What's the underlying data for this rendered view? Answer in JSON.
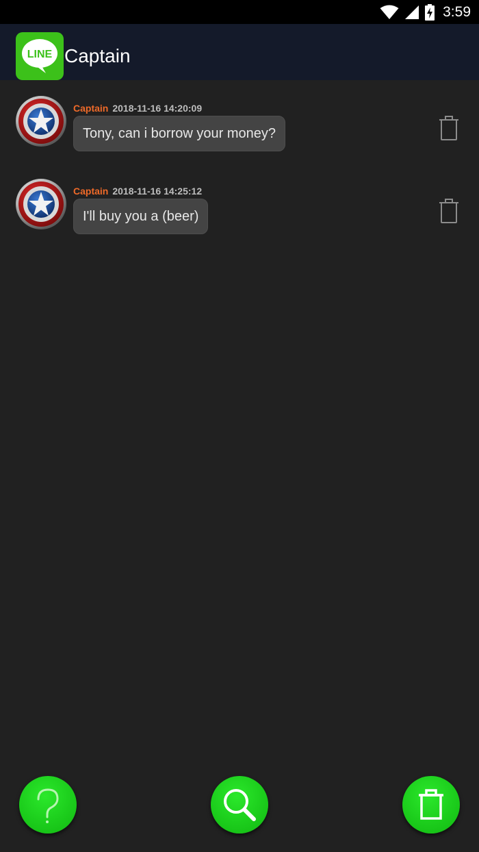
{
  "status_bar": {
    "time": "3:59",
    "icons": [
      "wifi-icon",
      "cell-signal-icon",
      "battery-charging-icon"
    ]
  },
  "app_bar": {
    "logo_text": "LINE",
    "title": "Captain"
  },
  "messages": [
    {
      "sender": "Captain",
      "timestamp": "2018-11-16 14:20:09",
      "text": "Tony, can i borrow your money?"
    },
    {
      "sender": "Captain",
      "timestamp": "2018-11-16 14:25:12",
      "text": "I'll buy you a (beer)"
    }
  ],
  "actions": {
    "icons": [
      "help-icon",
      "search-icon",
      "trash-icon"
    ]
  },
  "colors": {
    "background": "#212121",
    "app_bar": "#141a2a",
    "sender": "#ef6a29",
    "bubble": "#444444",
    "fab": "#1ccd1c",
    "logo": "#3cc11a"
  }
}
